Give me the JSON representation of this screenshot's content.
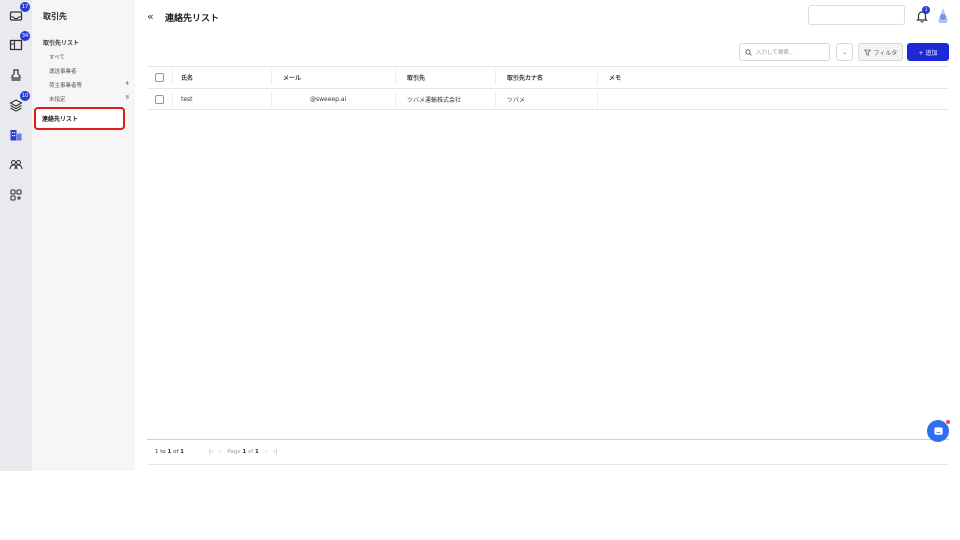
{
  "rail": {
    "items": [
      {
        "icon": "inbox-icon",
        "badge": "17"
      },
      {
        "icon": "board-icon",
        "badge": "34"
      },
      {
        "icon": "stamp-icon",
        "badge": ""
      },
      {
        "icon": "layers-icon",
        "badge": "10"
      },
      {
        "icon": "building-icon",
        "badge": ""
      },
      {
        "icon": "people-icon",
        "badge": ""
      },
      {
        "icon": "apps-icon",
        "badge": ""
      }
    ]
  },
  "sidebar": {
    "title": "取引先",
    "group_label": "取引先リスト",
    "items": [
      {
        "label": "すべて",
        "count": ""
      },
      {
        "label": "運送事業者",
        "count": ""
      },
      {
        "label": "荷主事業者等",
        "count": "4"
      },
      {
        "label": "未指定",
        "count": "8"
      }
    ],
    "selected_label": "連絡先リスト"
  },
  "header": {
    "title": "連絡先リスト",
    "bell_badge": "3"
  },
  "toolbar": {
    "search_placeholder": "入力して検索...",
    "filter_label": "フィルタ",
    "add_label": "+ 追加"
  },
  "table": {
    "columns": [
      "氏名",
      "メール",
      "取引先",
      "取引先カナ名",
      "メモ"
    ],
    "rows": [
      {
        "name": "test",
        "email": "@sweeep.ai",
        "company": "ツバメ運輸株式会社",
        "company_kana": "ツバメ",
        "memo": ""
      }
    ]
  },
  "footer": {
    "rows_prefix": "1 to ",
    "rows_a": "1",
    "rows_of": " of ",
    "rows_b": "1",
    "page_prefix": "Page ",
    "page_current": "1",
    "page_of": " of ",
    "page_total": "1"
  },
  "colors": {
    "accent": "#1d28d6",
    "badge": "#2a3bd8",
    "selected_outline": "#e01b1b",
    "chat": "#2e6ff2"
  }
}
